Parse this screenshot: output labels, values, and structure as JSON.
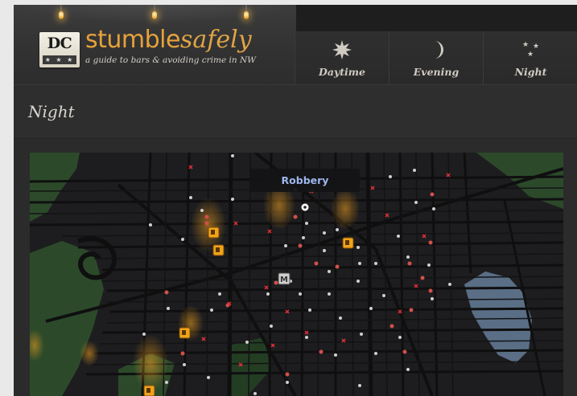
{
  "logo": {
    "badge": "DC",
    "badge_stars": "★ ★ ★",
    "brand_first": "stumble",
    "brand_second": "safely",
    "tagline": "a guide to bars & avoiding crime in NW"
  },
  "tabs": [
    {
      "label": "Daytime",
      "icon": "sun-icon"
    },
    {
      "label": "Evening",
      "icon": "moon-icon"
    },
    {
      "label": "Night",
      "icon": "stars-icon"
    }
  ],
  "page": {
    "title": "Night"
  },
  "map": {
    "tooltip": "Robbery",
    "metro_label": "M",
    "colors": {
      "background": "#1d1d1f",
      "street": "#0f0f10",
      "park": "#2c4a2a",
      "water": "#5a6e86",
      "crime_dot": "#d2504a",
      "crime_x": "#e2303a",
      "white_dot": "#cfcfcf",
      "bar_marker": "#f1a31a",
      "glow": "#f0a020"
    },
    "markers": {
      "bars": 6,
      "metro": 1,
      "selected_incident": 1
    }
  },
  "colors": {
    "accent": "#e7a23a",
    "tooltip_text": "#9eb6ec",
    "header_bg": "#2b2b2b"
  }
}
